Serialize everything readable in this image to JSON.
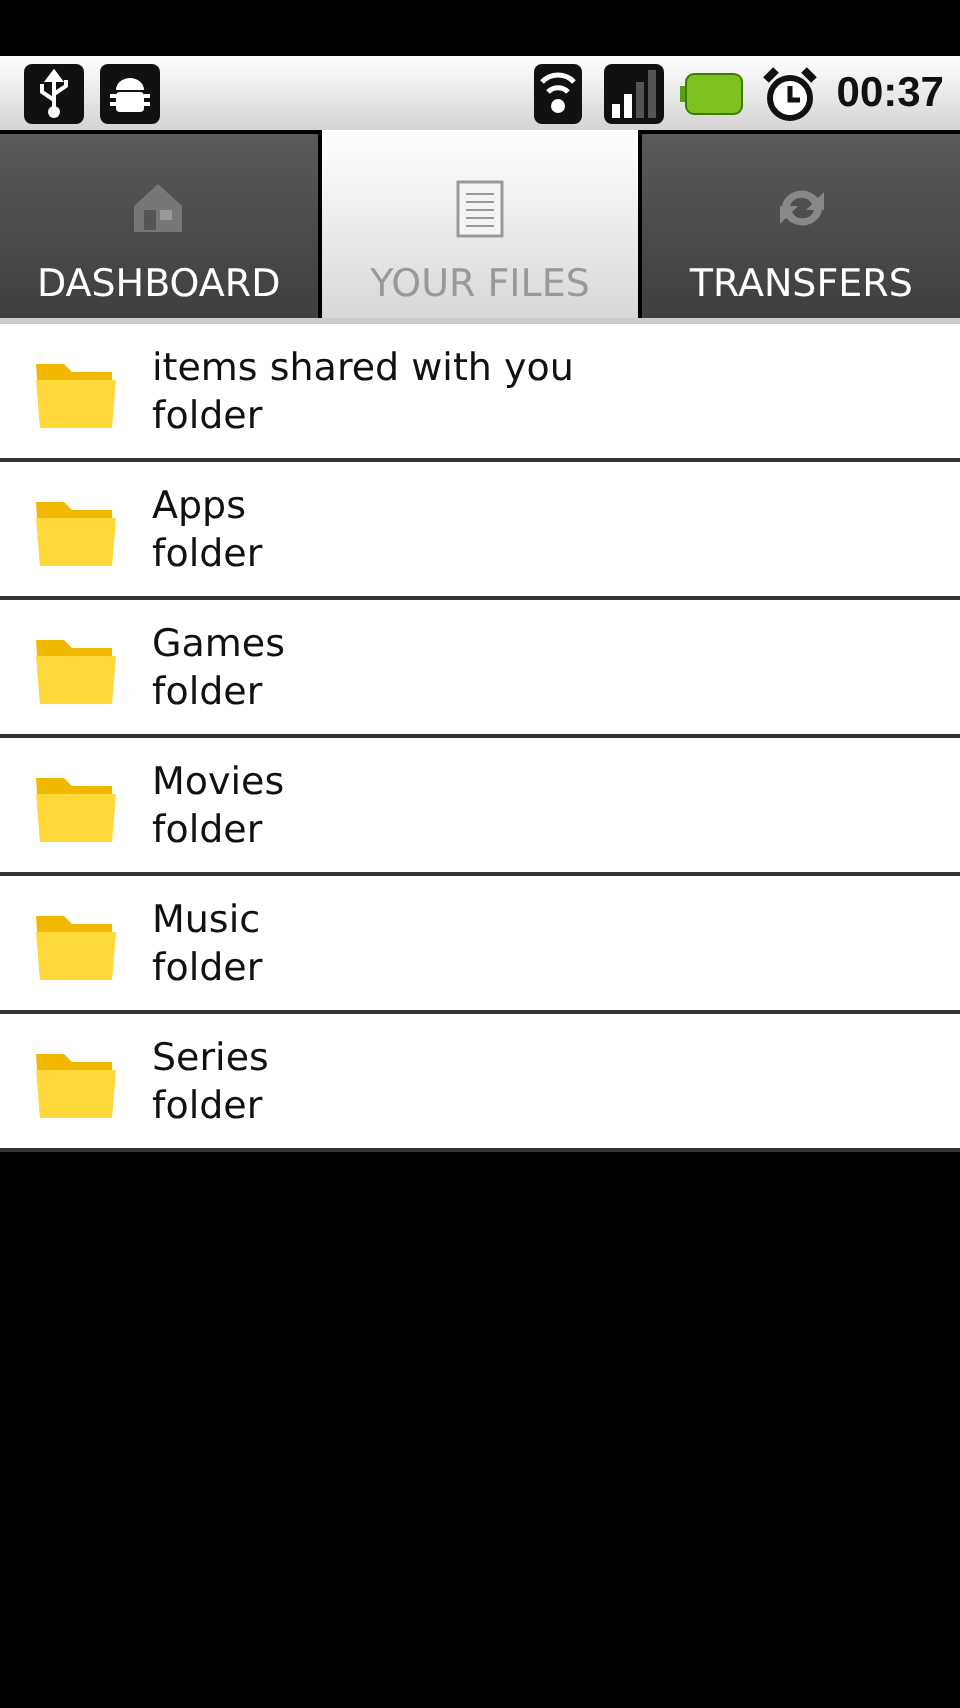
{
  "status_bar": {
    "time": "00:37"
  },
  "tabs": [
    {
      "label": "DASHBOARD",
      "selected": false
    },
    {
      "label": "YOUR FILES",
      "selected": true
    },
    {
      "label": "TRANSFERS",
      "selected": false
    }
  ],
  "items": [
    {
      "name": "items shared with you",
      "type": "folder"
    },
    {
      "name": "Apps",
      "type": "folder"
    },
    {
      "name": "Games",
      "type": "folder"
    },
    {
      "name": "Movies",
      "type": "folder"
    },
    {
      "name": "Music",
      "type": "folder"
    },
    {
      "name": "Series",
      "type": "folder"
    }
  ]
}
